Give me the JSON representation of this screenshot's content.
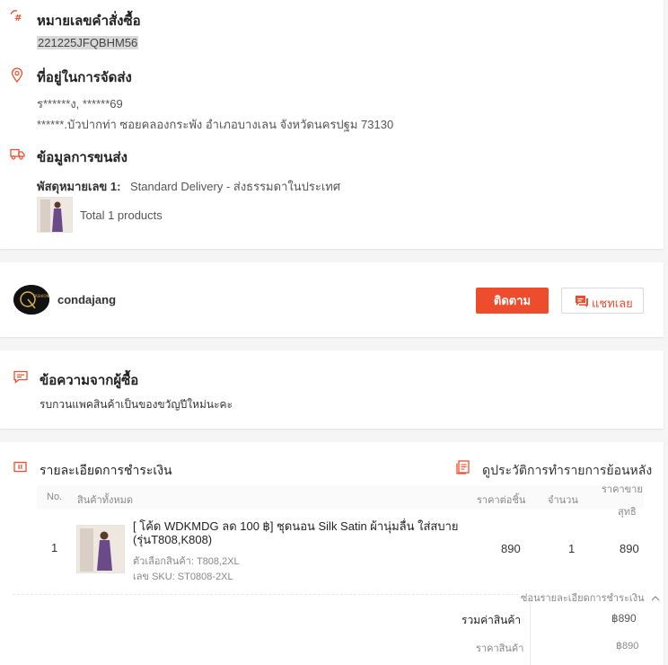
{
  "order": {
    "number_title": "หมายเลขคำสั่งซื้อ",
    "number_value": "221225JFQBHM56",
    "address_title": "ที่อยู่ในการจัดส่ง",
    "address_name": "ร******ง, ******69",
    "address_line": "******.บัวปากท่า ซอยคลองกระพัง อำเภอบางเลน จังหวัดนครปฐม 73130",
    "shipping_title": "ข้อมูลการขนส่ง",
    "parcel_label": "พัสดุหมายเลข 1:",
    "parcel_value": "Standard Delivery - ส่งธรรมดาในประเทศ",
    "total_products": "Total 1 products"
  },
  "shop": {
    "name": "condajang",
    "logo_text": "FASHION",
    "follow_label": "ติดตาม",
    "chat_label": "แชทเลย"
  },
  "message": {
    "title": "ข้อความจากผู้ซื้อ",
    "text": "รบกวนแพคสินค้าเป็นของขวัญปีใหม่นะคะ"
  },
  "payment": {
    "title": "รายละเอียดการชำระเงิน",
    "history_link": "ดูประวัติการทำรายการย้อนหลัง",
    "table": {
      "col_no": "No.",
      "col_products": "สินค้าทั้งหมด",
      "col_unit_price": "ราคาต่อชิ้น",
      "col_qty": "จำนวน",
      "col_net_line1": "ราคาขาย",
      "col_net_line2": "สุทธิ"
    },
    "rows": [
      {
        "no": "1",
        "name_line1": "[ โค้ด WDKMDG ลด 100 ฿] ชุดนอน Silk Satin ผ้านุ่มลื่น ใส่สบาย",
        "name_line2": "(รุ่นT808,K808)",
        "variation": "ตัวเลือกสินค้า: T808,2XL",
        "sku": "เลข SKU: ST0808-2XL",
        "unit_price": "890",
        "qty": "1",
        "net": "890"
      }
    ],
    "hide_details": "ซ่อนรายละเอียดการชำระเงิน",
    "summary": [
      {
        "label": "รวมค่าสินค้า",
        "value": "฿890"
      },
      {
        "label": "ราคาสินค้า",
        "value": "฿890"
      }
    ]
  },
  "colors": {
    "accent": "#ee4d2d"
  }
}
